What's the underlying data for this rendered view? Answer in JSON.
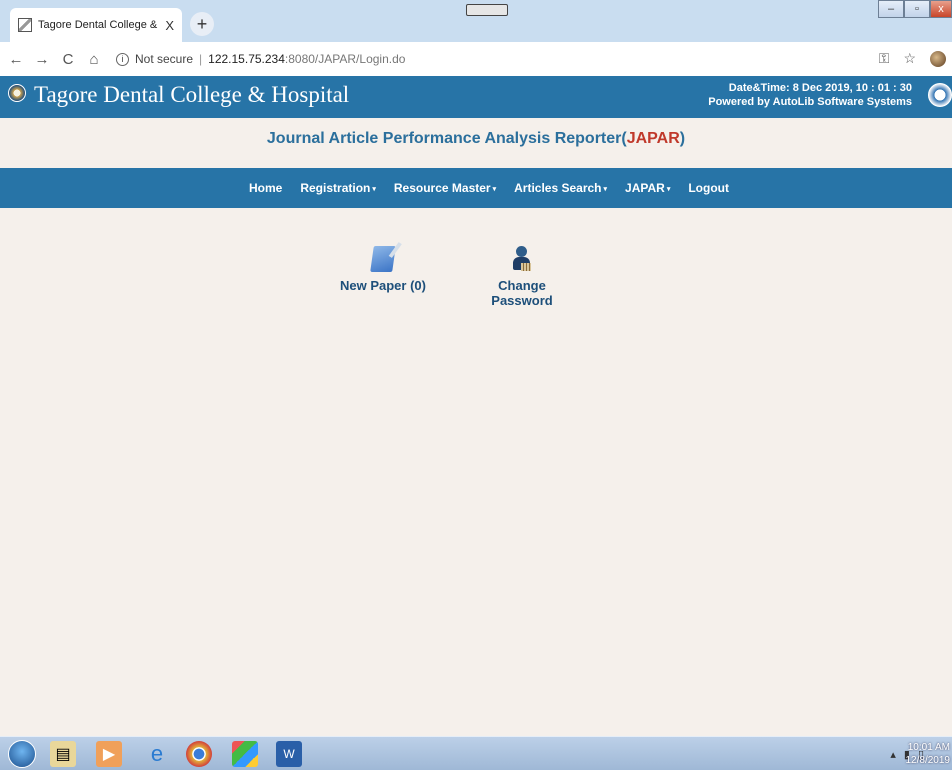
{
  "browser": {
    "tab_title": "Tagore Dental College & Hospita",
    "tab_close": "X",
    "new_tab": "+",
    "nav_back": "←",
    "nav_forward": "→",
    "nav_reload": "C",
    "nav_home": "⌂",
    "security": "Not secure",
    "url_host": "122.15.75.234",
    "url_path": ":8080/JAPAR/Login.do",
    "key_icon": "key-icon",
    "star_icon": "star-icon"
  },
  "site": {
    "title": "Tagore Dental College & Hospital",
    "datetime_label": "Date&Time:  8 Dec 2019, 10 : 01 : 30",
    "powered_by": "Powered by AutoLib Software Systems",
    "app_title_prefix": "Journal Article Performance Analysis Reporter(",
    "app_title_acronym": "JAPAR",
    "app_title_suffix": ")"
  },
  "nav": {
    "home": "Home",
    "registration": "Registration",
    "resource_master": "Resource Master",
    "articles_search": "Articles Search",
    "japar": "JAPAR",
    "logout": "Logout",
    "caret": "▾"
  },
  "content": {
    "new_paper": "New Paper (0)",
    "change_password": "Change Password"
  },
  "taskbar": {
    "time": "10:01 AM",
    "date": "12/8/2019"
  },
  "colors": {
    "header_blue": "#2774a7",
    "acronym_red": "#c0392b",
    "page_bg": "#f5f0eb"
  }
}
